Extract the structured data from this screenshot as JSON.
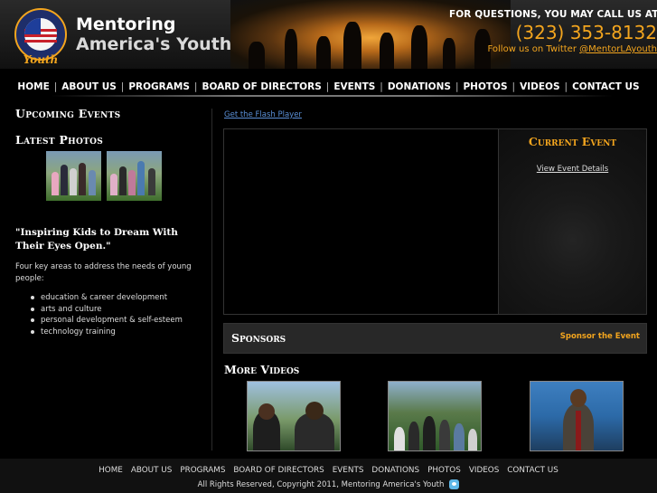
{
  "header": {
    "brand_line1": "Mentoring",
    "brand_line2": "America's Youth",
    "logo_text": "Mentoring America's Youth",
    "contact_question": "FOR QUESTIONS, YOU MAY CALL US AT",
    "phone": "(323) 353-8132",
    "twitter_prefix": "Follow us on Twitter ",
    "twitter_handle": "@MentorLAyouth"
  },
  "nav": {
    "items": [
      "HOME",
      "ABOUT US",
      "PROGRAMS",
      "BOARD OF DIRECTORS",
      "EVENTS",
      "DONATIONS",
      "PHOTOS",
      "VIDEOS",
      "CONTACT US"
    ],
    "separator": "|"
  },
  "left": {
    "upcoming_events": "Upcoming Events",
    "latest_photos": "Latest Photos",
    "quote": "\"Inspiring Kids to Dream With Their Eyes Open.\"",
    "description": "Four key areas to address the needs of young people:",
    "areas": [
      "education & career development",
      "arts and culture",
      "personal development & self-esteem",
      "technology training"
    ]
  },
  "main": {
    "flash_link": "Get the Flash Player",
    "current_event_title": "Current Event",
    "view_event_details": "View Event Details",
    "sponsors_title": "Sponsors",
    "sponsor_link": "Sponsor the Event",
    "more_videos_title": "More Videos"
  },
  "footer": {
    "items": [
      "HOME",
      "ABOUT US",
      "PROGRAMS",
      "BOARD OF DIRECTORS",
      "EVENTS",
      "DONATIONS",
      "PHOTOS",
      "VIDEOS",
      "CONTACT US"
    ],
    "copyright": "All Rights Reserved, Copyright 2011, Mentoring America's Youth"
  },
  "colors": {
    "accent_orange": "#f3a51e",
    "link_blue": "#5a8fd6",
    "background": "#000000"
  },
  "icons": {
    "logo": "mentoring-americas-youth-badge-icon",
    "twitter": "twitter-icon"
  }
}
